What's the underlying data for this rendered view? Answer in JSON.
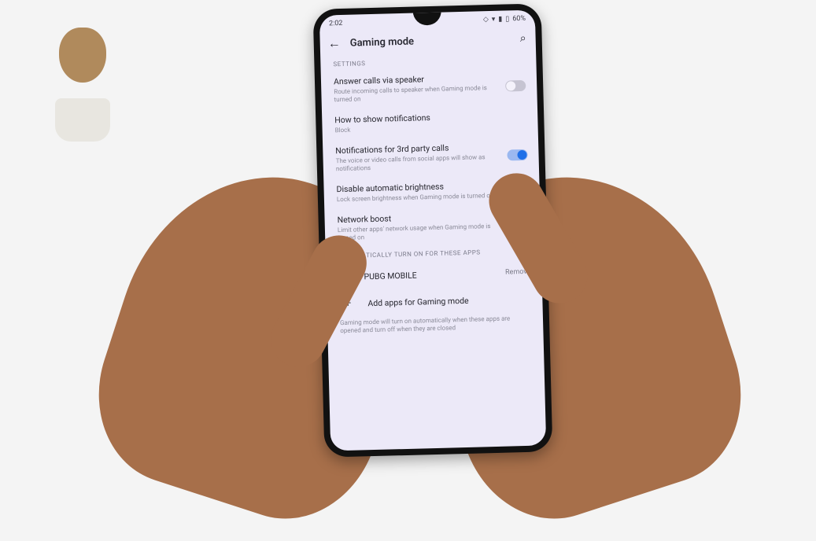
{
  "statusbar": {
    "time": "2:02",
    "battery": "60%"
  },
  "header": {
    "title": "Gaming mode"
  },
  "sections": {
    "settings_label": "SETTINGS",
    "auto_label": "AUTOMATICALLY TURN ON FOR THESE APPS"
  },
  "settings": [
    {
      "title": "Answer calls via speaker",
      "subtitle": "Route incoming calls to speaker when Gaming mode is turned on",
      "toggle": "off"
    },
    {
      "title": "How to show notifications",
      "subtitle": "Block",
      "toggle": null
    },
    {
      "title": "Notifications for 3rd party calls",
      "subtitle": "The voice or video calls from social apps will show as notifications",
      "toggle": "on"
    },
    {
      "title": "Disable automatic brightness",
      "subtitle": "Lock screen brightness when Gaming mode is turned on",
      "toggle": "off"
    },
    {
      "title": "Network boost",
      "subtitle": "Limit other apps' network usage when Gaming mode is turned on",
      "toggle": "on"
    }
  ],
  "apps": [
    {
      "name": "PUBG MOBILE",
      "action": "Remove"
    }
  ],
  "add_apps_label": "Add apps for Gaming mode",
  "footer_note": "Gaming mode will turn on automatically when these apps are opened and turn off when they are closed"
}
